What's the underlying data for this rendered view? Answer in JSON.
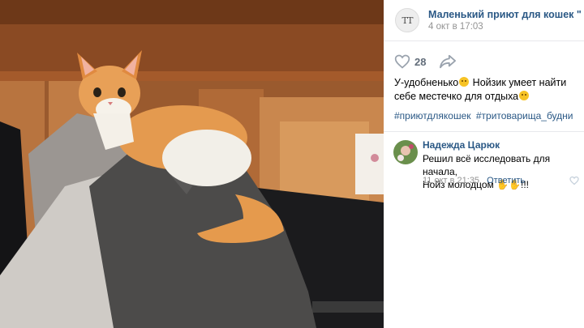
{
  "group": {
    "name": "Маленький приют для кошек \"Три",
    "avatar_text": "TT",
    "date": "4 окт в 17:03"
  },
  "actions": {
    "likes": "28",
    "like_icon": "heart-icon",
    "share_icon": "share-arrow-icon"
  },
  "post": {
    "text_part1": "У-удобненько",
    "text_part2": " Нойзик умеет найти себе местечко для отдыха",
    "hashtags": [
      "#приютдлякошек",
      "#тритоварища_будни"
    ]
  },
  "comment": {
    "author": "Надежда Царюк",
    "text_line1": "Решил всё исследовать для начала,",
    "text_line2": "Нойз молодцом ",
    "text_suffix": "!!!",
    "date": "11 окт в 21:35",
    "reply": "Ответить"
  },
  "colors": {
    "link": "#2a5885",
    "muted": "#939393",
    "divider": "#e7e8ec"
  }
}
